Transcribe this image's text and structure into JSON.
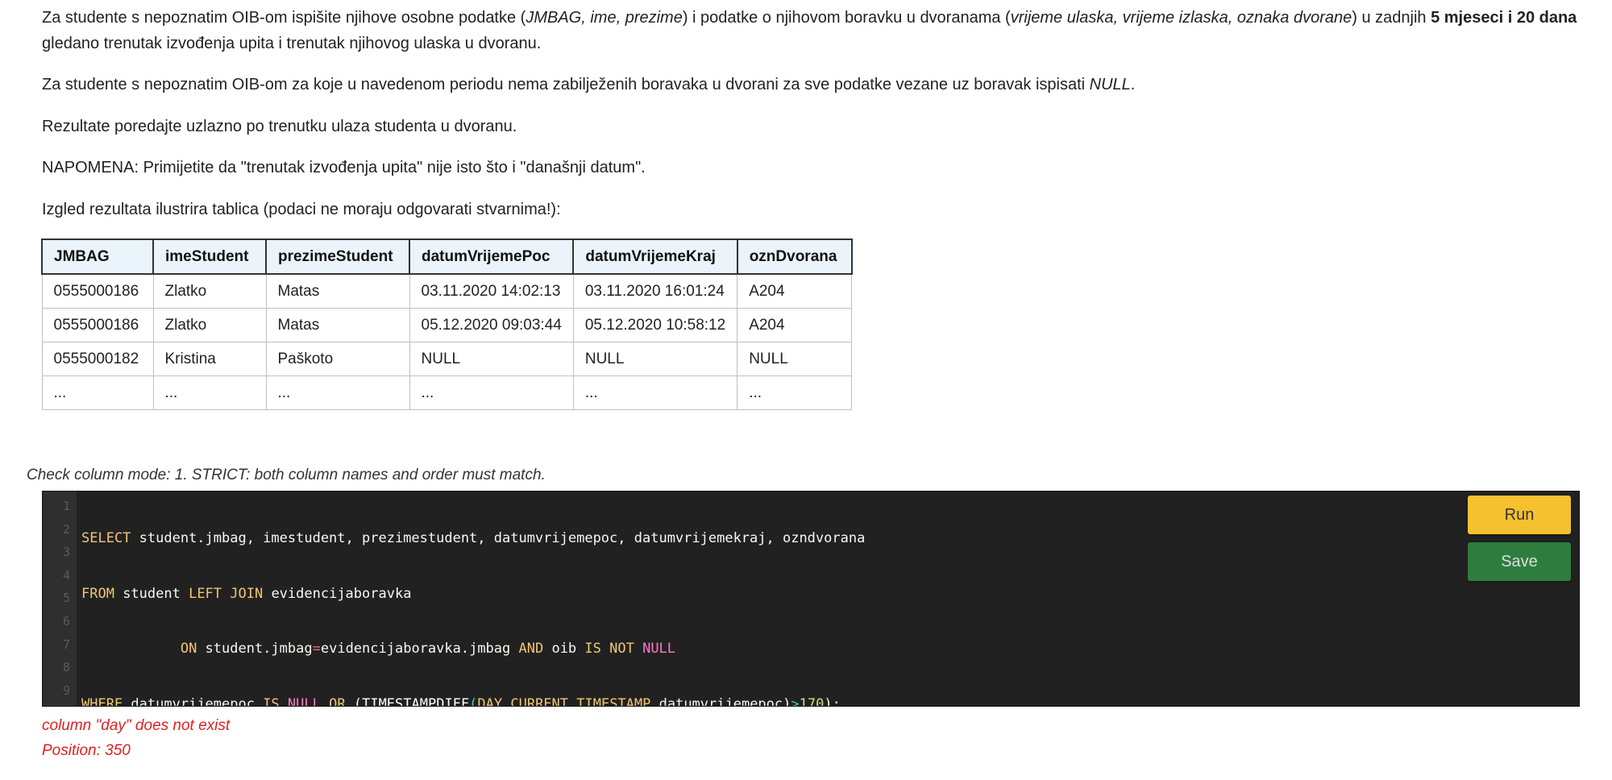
{
  "task": {
    "p1": {
      "a": "Za studente s nepoznatim OIB-om ispišite njihove osobne podatke (",
      "b": "JMBAG, ime, prezime",
      "c": ") i podatke o njihovom boravku u dvoranama (",
      "d": "vrijeme ulaska, vrijeme izlaska, oznaka dvorane",
      "e": ") u zadnjih ",
      "f": "5 mjeseci i 20 dana",
      "g": " gledano trenutak izvođenja upita i trenutak njihovog ulaska u dvoranu."
    },
    "p2": {
      "a": "Za studente s nepoznatim OIB-om za koje u navedenom periodu nema zabilježenih boravaka u dvorani za sve podatke vezane uz boravak ispisati ",
      "b": "NULL",
      "c": "."
    },
    "p3": "Rezultate poredajte uzlazno po trenutku ulaza studenta u dvoranu.",
    "p4": "NAPOMENA: Primijetite da \"trenutak izvođenja upita\" nije isto što i \"današnji datum\".",
    "p5": "Izgled rezultata ilustrira tablica (podaci ne moraju odgovarati stvarnima!):"
  },
  "table": {
    "headers": [
      "JMBAG",
      "imeStudent",
      "prezimeStudent",
      "datumVrijemePoc",
      "datumVrijemeKraj",
      "oznDvorana"
    ],
    "rows": [
      [
        "0555000186",
        "Zlatko",
        "Matas",
        "03.11.2020 14:02:13",
        "03.11.2020 16:01:24",
        "A204"
      ],
      [
        "0555000186",
        "Zlatko",
        "Matas",
        "05.12.2020 09:03:44",
        "05.12.2020 10:58:12",
        "A204"
      ],
      [
        "0555000182",
        "Kristina",
        "Paškoto",
        "NULL",
        "NULL",
        "NULL"
      ],
      [
        "...",
        "...",
        "...",
        "...",
        "...",
        "..."
      ]
    ]
  },
  "check_mode": "Check column mode: 1. STRICT: both column names and order must match.",
  "editor": {
    "line_numbers": [
      "1",
      "2",
      "3",
      "4",
      "5",
      "6",
      "7",
      "8",
      "9"
    ],
    "l1": {
      "kw": "SELECT",
      "rest": " student.jmbag, imestudent, prezimestudent, datumvrijemepoc, datumvrijemekraj, ozndvorana"
    },
    "l2": {
      "kw1": "FROM",
      "t1": " student ",
      "kw2": "LEFT JOIN",
      "t2": " evidencijaboravka"
    },
    "l3": {
      "indent": "            ",
      "kw1": "ON",
      "t1": " student.jmbag",
      "op": "=",
      "t2": "evidencijaboravka.jmbag ",
      "kw2": "AND",
      "t3": " oib ",
      "kw3": "IS NOT",
      "sp": " ",
      "kw4": "NULL"
    },
    "l4": {
      "kw1": "WHERE",
      "t1": " datumvrijemepoc ",
      "kw2": "IS",
      "sp": " ",
      "kw3": "NULL",
      "sp2": " ",
      "kw4": "OR",
      "t2": " (",
      "fn": "TIMESTAMPDIFF",
      "t3": "(",
      "kw5": "DAY",
      "t4": ",",
      "kw6": "CURRENT_TIMESTAMP",
      "t5": ",datumvrijemepoc)",
      "op": ">",
      "num": "170",
      "t6": ");"
    }
  },
  "buttons": {
    "run": "Run",
    "save": "Save"
  },
  "error": {
    "message": "column \"day\" does not exist",
    "position": "Position: 350"
  },
  "colors": {
    "run": "#f6c12e",
    "save": "#2e7d3e",
    "error": "#e02020",
    "editor_bg": "#212121",
    "keyword": "#f0c674"
  }
}
